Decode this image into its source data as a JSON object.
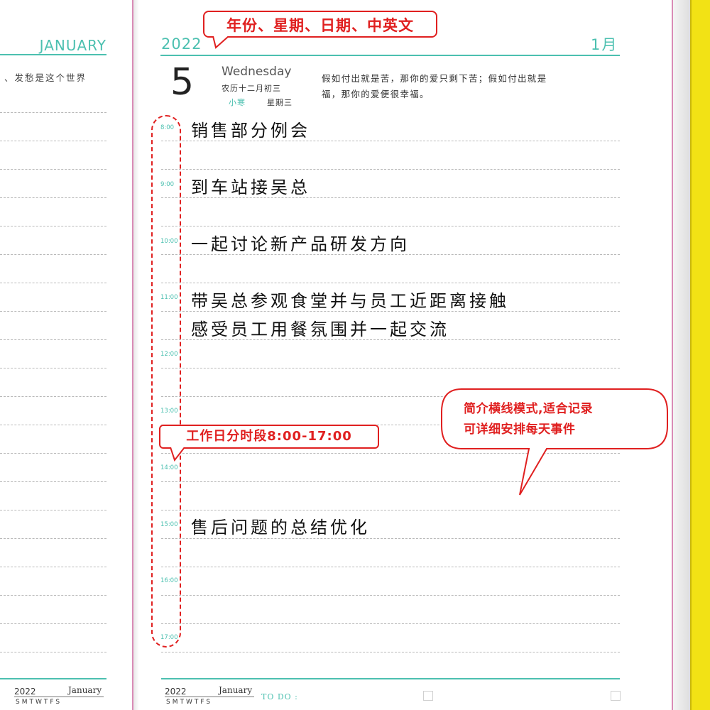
{
  "left_page": {
    "month": "JANUARY",
    "quote_fragment": "、发愁是这个世界"
  },
  "header": {
    "year": "2022",
    "month_cn": "1月"
  },
  "date_block": {
    "day": "5",
    "weekday_en": "Wednesday",
    "lunar_date": "农历十二月初三",
    "solar_term": "小寒",
    "weekday_cn": "星期三"
  },
  "quote": {
    "line1": "假如付出就是苦，那你的爱只剩下苦；假如付出就是",
    "line2": "福，那你的爱便很幸福。"
  },
  "times": [
    "8:00",
    "9:00",
    "10:00",
    "11:00",
    "12:00",
    "13:00",
    "14:00",
    "15:00",
    "16:00",
    "17:00"
  ],
  "entries": {
    "e1": "销售部分例会",
    "e2": "到车站接吴总",
    "e3": "一起讨论新产品研发方向",
    "e4_line1": "带吴总参观食堂并与员工近距离接触",
    "e4_line2": "感受员工用餐氛围并一起交流",
    "e5": "售后问题的总结优化"
  },
  "footer": {
    "cal_year": "2022",
    "cal_month": "January",
    "cal_days": "SMTWTFS",
    "todo_label": "TO DO :"
  },
  "annotations": {
    "top_callout": "年份、星期、日期、中英文",
    "time_callout": "工作日分时段8:00-17:00",
    "desc_line1": "简介横线模式,适合记录",
    "desc_line2": "可详细安排每天事件"
  },
  "colors": {
    "accent_teal": "#4cc0b0",
    "annotation_red": "#e02020",
    "spine_pink": "#d98bb6",
    "edge_yellow": "#f2e215"
  }
}
